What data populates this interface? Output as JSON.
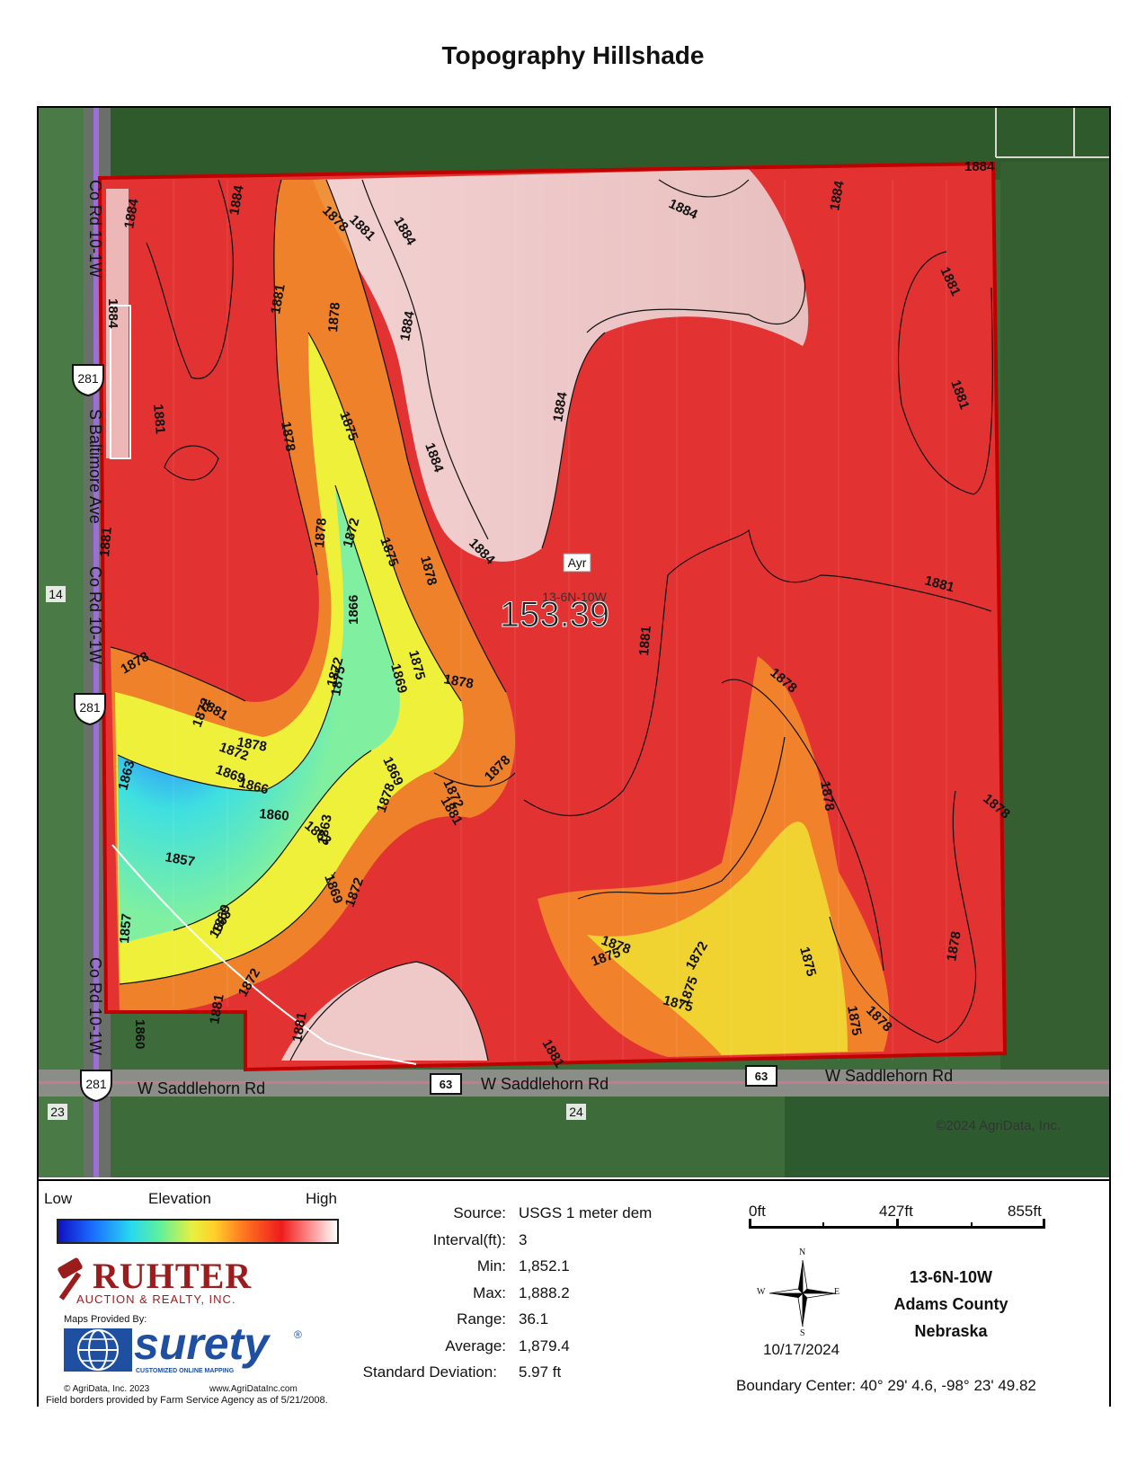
{
  "title": "Topography Hillshade",
  "map": {
    "roads": {
      "co_rd_top": "Co Rd 10-1W",
      "co_rd_mid": "Co Rd 10-1W",
      "co_rd_bottom": "Co Rd 10-1W",
      "s_baltimore": "S Baltimore Ave",
      "saddlehorn_left": "W Saddlehorn Rd",
      "saddlehorn_mid": "W Saddlehorn Rd",
      "saddlehorn_right": "W Saddlehorn Rd"
    },
    "shields": {
      "us281_a": "281",
      "us281_b": "281",
      "us281_c": "281",
      "sh63_a": "63",
      "sh63_b": "63"
    },
    "section_numbers": {
      "s14": "14",
      "s23": "23",
      "s24": "24"
    },
    "place_label": "Ayr",
    "section_label": "13-6N-10W",
    "acreage": "153.39",
    "copyright": "©2024 AgriData, Inc.",
    "contour_labels": [
      {
        "text": "1884"
      },
      {
        "text": "1884"
      },
      {
        "text": "1884"
      },
      {
        "text": "1884"
      },
      {
        "text": "1884"
      },
      {
        "text": "1884"
      },
      {
        "text": "1884"
      },
      {
        "text": "1884"
      },
      {
        "text": "1884"
      },
      {
        "text": "1884"
      },
      {
        "text": "1884"
      },
      {
        "text": "1881"
      },
      {
        "text": "1881"
      },
      {
        "text": "1881"
      },
      {
        "text": "1881"
      },
      {
        "text": "1881"
      },
      {
        "text": "1881"
      },
      {
        "text": "1881"
      },
      {
        "text": "1881"
      },
      {
        "text": "1881"
      },
      {
        "text": "1881"
      },
      {
        "text": "1881"
      },
      {
        "text": "1881"
      },
      {
        "text": "1881"
      },
      {
        "text": "1878"
      },
      {
        "text": "1878"
      },
      {
        "text": "1878"
      },
      {
        "text": "1878"
      },
      {
        "text": "1878"
      },
      {
        "text": "1878"
      },
      {
        "text": "1878"
      },
      {
        "text": "1878"
      },
      {
        "text": "1878"
      },
      {
        "text": "1878"
      },
      {
        "text": "1878"
      },
      {
        "text": "1878"
      },
      {
        "text": "1878"
      },
      {
        "text": "1878"
      },
      {
        "text": "1878"
      },
      {
        "text": "1878"
      },
      {
        "text": "1875"
      },
      {
        "text": "1875"
      },
      {
        "text": "1875"
      },
      {
        "text": "1875"
      },
      {
        "text": "1875"
      },
      {
        "text": "1875"
      },
      {
        "text": "1875"
      },
      {
        "text": "1875"
      },
      {
        "text": "1875"
      },
      {
        "text": "1872"
      },
      {
        "text": "1872"
      },
      {
        "text": "1872"
      },
      {
        "text": "1872"
      },
      {
        "text": "1872"
      },
      {
        "text": "1872"
      },
      {
        "text": "1872"
      },
      {
        "text": "1872"
      },
      {
        "text": "1869"
      },
      {
        "text": "1869"
      },
      {
        "text": "1869"
      },
      {
        "text": "1869"
      },
      {
        "text": "1869"
      },
      {
        "text": "1866"
      },
      {
        "text": "1866"
      },
      {
        "text": "1863"
      },
      {
        "text": "1863"
      },
      {
        "text": "1863"
      },
      {
        "text": "1863"
      },
      {
        "text": "1860"
      },
      {
        "text": "1860"
      },
      {
        "text": "1857"
      },
      {
        "text": "1857"
      }
    ]
  },
  "legend": {
    "ramp_low": "Low",
    "ramp_title": "Elevation",
    "ramp_high": "High",
    "ramp_colors": [
      "#1010c0",
      "#1a6bff",
      "#28d8f0",
      "#5cf0a0",
      "#e8f040",
      "#ffd02a",
      "#ff7a20",
      "#ee1c1c",
      "#ff8a8a",
      "#ffffff"
    ],
    "stats": [
      {
        "label": "Source:",
        "value": "USGS 1 meter dem"
      },
      {
        "label": "Interval(ft):",
        "value": "3"
      },
      {
        "label": "Min:",
        "value": "1,852.1"
      },
      {
        "label": "Max:",
        "value": "1,888.2"
      },
      {
        "label": "Range:",
        "value": "36.1"
      },
      {
        "label": "Average:",
        "value": "1,879.4"
      },
      {
        "label": "Standard Deviation:",
        "value": "5.97 ft"
      }
    ],
    "scale": {
      "t0": "0ft",
      "t1": "427ft",
      "t2": "855ft"
    },
    "compass": {
      "n": "N",
      "s": "S",
      "e": "E",
      "w": "W"
    },
    "date": "10/17/2024",
    "location": {
      "line1": "13-6N-10W",
      "line2": "Adams County",
      "line3": "Nebraska"
    },
    "boundary_center": "Boundary Center: 40° 29' 4.6,  -98° 23' 49.82",
    "ruhter_name": "RUHTER",
    "ruhter_sub": "AUCTION & REALTY, INC.",
    "maps_provided": "Maps Provided By:",
    "surety_name": "surety",
    "surety_reg": "®",
    "surety_tag": "CUSTOMIZED ONLINE MAPPING",
    "agridata_copy": "© AgriData, Inc. 2023",
    "agridata_url": "www.AgriDataInc.com",
    "field_borders": "Field borders provided by Farm Service Agency as of 5/21/2008."
  }
}
